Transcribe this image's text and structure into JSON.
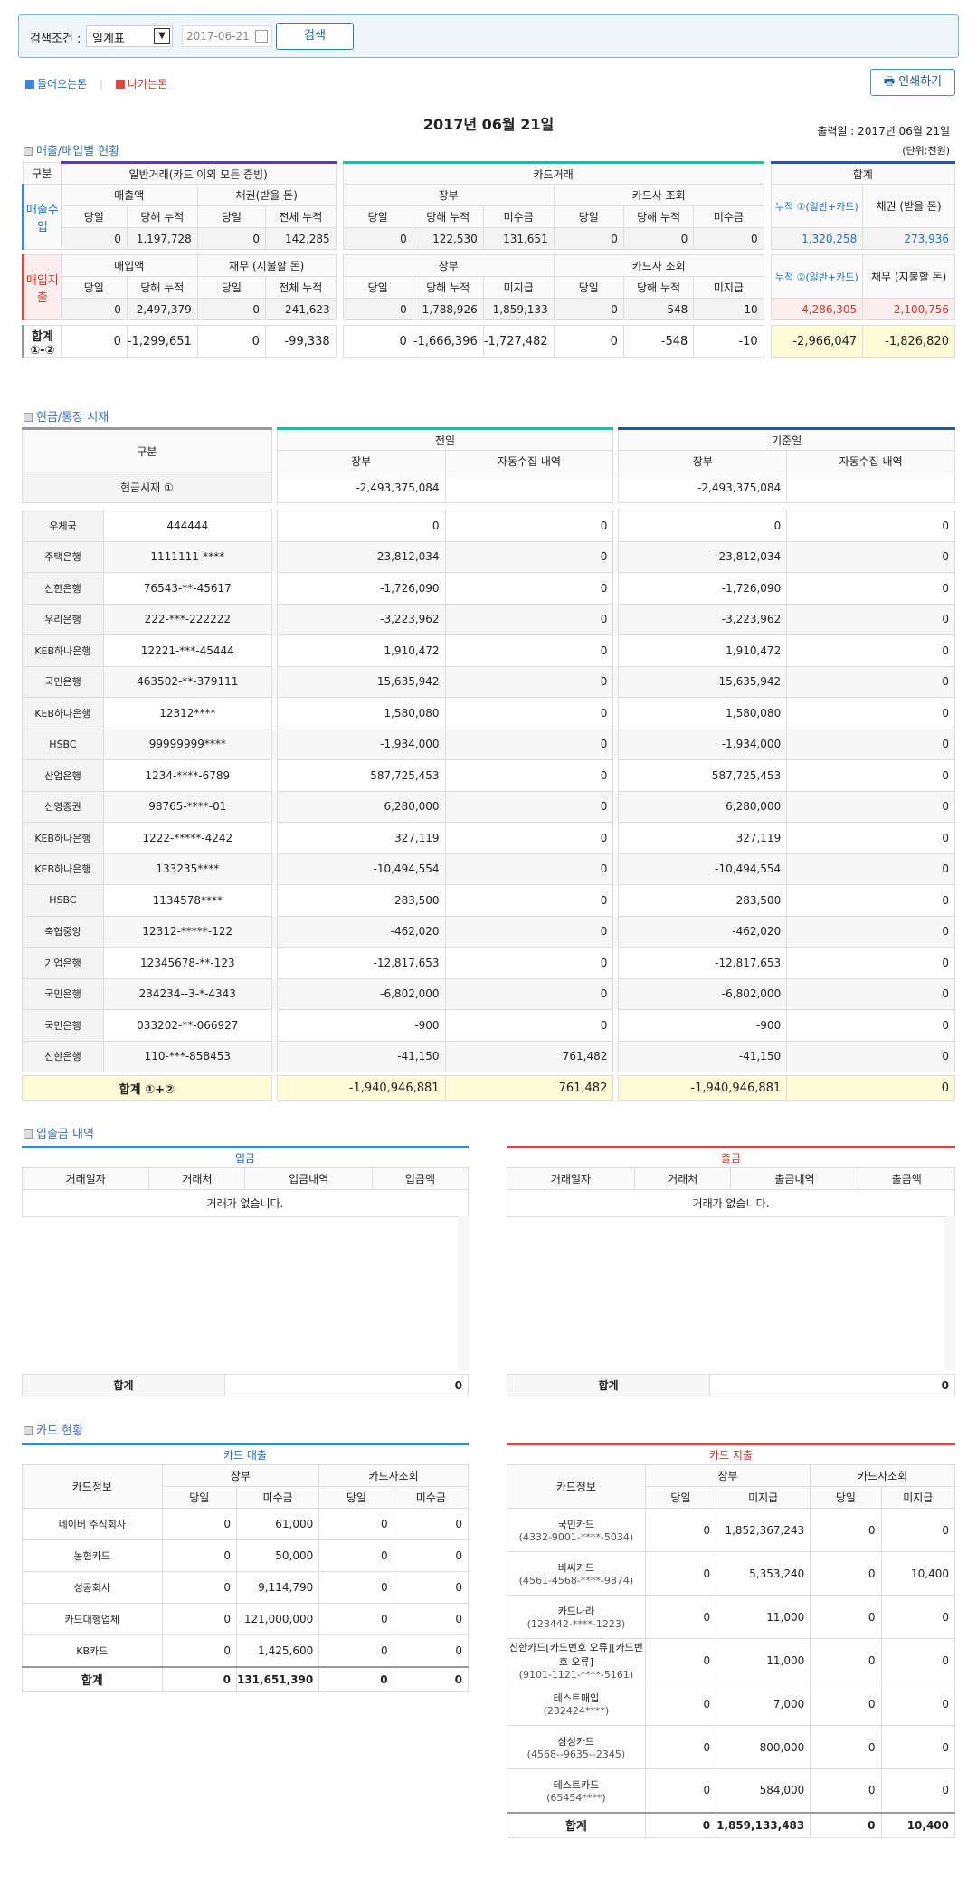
{
  "search": {
    "label": "검색조건 :",
    "period": "일계표",
    "date": "2017-06-21",
    "button": "검색"
  },
  "legend": {
    "incoming": "들어오는돈",
    "outgoing": "나가는돈"
  },
  "print_label": "인쇄하기",
  "title": "2017년 06월 21일",
  "print_date": "출력일 : 2017년 06월 21일",
  "unit": "(단위:천원)",
  "sec1": "매출/매입별 현황",
  "sec2": "현금/통장 시재",
  "sec3": "입출금 내역",
  "sec4": "카드 현황",
  "s1": {
    "h_gubun": "구분",
    "h_general": "일반거래(카드 이외 모든 증빙)",
    "h_card": "카드거래",
    "h_sum": "합계",
    "sales": {
      "label": "매출수입",
      "amt": "매출액",
      "bond": "채권(받을 돈)",
      "book": "장부",
      "cardco": "카드사 조회",
      "cum": "누적 ①(일반+카드)",
      "bondsum": "채권 (받을 돈)",
      "cols": [
        "당일",
        "당해 누적",
        "당일",
        "전체 누적",
        "당일",
        "당해 누적",
        "미수금",
        "당일",
        "당해 누적",
        "미수금"
      ],
      "vals": [
        "0",
        "1,197,728",
        "0",
        "142,285",
        "0",
        "122,530",
        "131,651",
        "0",
        "0",
        "0"
      ],
      "sum1": "1,320,258",
      "sum2": "273,936"
    },
    "buy": {
      "label": "매입지출",
      "amt": "매입액",
      "debt": "채무 (지불할 돈)",
      "book": "장부",
      "cardco": "카드사 조회",
      "cum": "누적 ②(일반+카드)",
      "debtsum": "채무 (지불할 돈)",
      "cols": [
        "당일",
        "당해 누적",
        "당일",
        "전체 누적",
        "당일",
        "당해 누적",
        "미지급",
        "당일",
        "당해 누적",
        "미지급"
      ],
      "vals": [
        "0",
        "2,497,379",
        "0",
        "241,623",
        "0",
        "1,788,926",
        "1,859,133",
        "0",
        "548",
        "10"
      ],
      "sum1": "4,286,305",
      "sum2": "2,100,756"
    },
    "total": {
      "label": "합계 ①-②",
      "vals": [
        "0",
        "-1,299,651",
        "0",
        "-99,338",
        "0",
        "-1,666,396",
        "-1,727,482",
        "0",
        "-548",
        "-10"
      ],
      "sum1": "-2,966,047",
      "sum2": "-1,826,820"
    }
  },
  "s2": {
    "h_gubun": "구분",
    "h_prev": "전일",
    "h_base": "기준일",
    "h_book": "장부",
    "h_auto": "자동수집 내역",
    "cash_label": "현금시재 ①",
    "cash_prev": "-2,493,375,084",
    "cash_base": "-2,493,375,084",
    "rows": [
      [
        "우체국",
        "444444",
        "0",
        "0",
        "0",
        "0"
      ],
      [
        "주택은행",
        "1111111-****",
        "-23,812,034",
        "0",
        "-23,812,034",
        "0"
      ],
      [
        "신한은행",
        "76543-**-45617",
        "-1,726,090",
        "0",
        "-1,726,090",
        "0"
      ],
      [
        "우리은행",
        "222-***-222222",
        "-3,223,962",
        "0",
        "-3,223,962",
        "0"
      ],
      [
        "KEB하나은행",
        "12221-***-45444",
        "1,910,472",
        "0",
        "1,910,472",
        "0"
      ],
      [
        "국민은행",
        "463502-**-379111",
        "15,635,942",
        "0",
        "15,635,942",
        "0"
      ],
      [
        "KEB하나은행",
        "12312****",
        "1,580,080",
        "0",
        "1,580,080",
        "0"
      ],
      [
        "HSBC",
        "99999999****",
        "-1,934,000",
        "0",
        "-1,934,000",
        "0"
      ],
      [
        "산업은행",
        "1234-****-6789",
        "587,725,453",
        "0",
        "587,725,453",
        "0"
      ],
      [
        "신영증권",
        "98765-****-01",
        "6,280,000",
        "0",
        "6,280,000",
        "0"
      ],
      [
        "KEB하나은행",
        "1222-*****-4242",
        "327,119",
        "0",
        "327,119",
        "0"
      ],
      [
        "KEB하나은행",
        "133235****",
        "-10,494,554",
        "0",
        "-10,494,554",
        "0"
      ],
      [
        "HSBC",
        "1134578****",
        "283,500",
        "0",
        "283,500",
        "0"
      ],
      [
        "축협중앙",
        "12312-*****-122",
        "-462,020",
        "0",
        "-462,020",
        "0"
      ],
      [
        "기업은행",
        "12345678-**-123",
        "-12,817,653",
        "0",
        "-12,817,653",
        "0"
      ],
      [
        "국민은행",
        "234234--3-*-4343",
        "-6,802,000",
        "0",
        "-6,802,000",
        "0"
      ],
      [
        "국민은행",
        "033202-**-066927",
        "-900",
        "0",
        "-900",
        "0"
      ],
      [
        "신한은행",
        "110-***-858453",
        "-41,150",
        "761,482",
        "-41,150",
        "0"
      ]
    ],
    "total_label": "합계 ①+②",
    "total": [
      "-1,940,946,881",
      "761,482",
      "-1,940,946,881",
      "0"
    ]
  },
  "s3": {
    "in_title": "입금",
    "out_title": "출금",
    "in_cols": [
      "거래일자",
      "거래처",
      "입금내역",
      "입금액"
    ],
    "out_cols": [
      "거래일자",
      "거래처",
      "출금내역",
      "출금액"
    ],
    "empty": "거래가 없습니다.",
    "sum_label": "합계",
    "in_sum": "0",
    "out_sum": "0"
  },
  "s4": {
    "sales_title": "카드 매출",
    "spend_title": "카드 지출",
    "info": "카드정보",
    "book": "장부",
    "cardco": "카드사조회",
    "sales_cols": [
      "당일",
      "미수금",
      "당일",
      "미수금"
    ],
    "spend_cols": [
      "당일",
      "미지급",
      "당일",
      "미지급"
    ],
    "sales_rows": [
      [
        "네이버 주식회사",
        "0",
        "61,000",
        "0",
        "0"
      ],
      [
        "농협카드",
        "0",
        "50,000",
        "0",
        "0"
      ],
      [
        "성공회사",
        "0",
        "9,114,790",
        "0",
        "0"
      ],
      [
        "카드대행업체",
        "0",
        "121,000,000",
        "0",
        "0"
      ],
      [
        "KB카드",
        "0",
        "1,425,600",
        "0",
        "0"
      ]
    ],
    "sales_total": [
      "0",
      "131,651,390",
      "0",
      "0"
    ],
    "spend_rows": [
      [
        "국민카드",
        "(4332-9001-****-5034)",
        "0",
        "1,852,367,243",
        "0",
        "0"
      ],
      [
        "비씨카드",
        "(4561-4568-****-9874)",
        "0",
        "5,353,240",
        "0",
        "10,400"
      ],
      [
        "카드나라",
        "(123442-****-1223)",
        "0",
        "11,000",
        "0",
        "0"
      ],
      [
        "신한카드[카드번호 오류][카드번호 오류]",
        "(9101-1121-****-5161)",
        "0",
        "11,000",
        "0",
        "0"
      ],
      [
        "테스트매입",
        "(232424****)",
        "0",
        "7,000",
        "0",
        "0"
      ],
      [
        "삼성카드",
        "(4568--9635--2345)",
        "0",
        "800,000",
        "0",
        "0"
      ],
      [
        "테스트카드",
        "(65454****)",
        "0",
        "584,000",
        "0",
        "0"
      ]
    ],
    "spend_total": [
      "0",
      "1,859,133,483",
      "0",
      "10,400"
    ],
    "total_label": "합계"
  },
  "colors": {
    "accent": "#3b71b7",
    "in": "#1a6fc9",
    "out": "#d8322d",
    "total_bg": "#fffbd6"
  }
}
